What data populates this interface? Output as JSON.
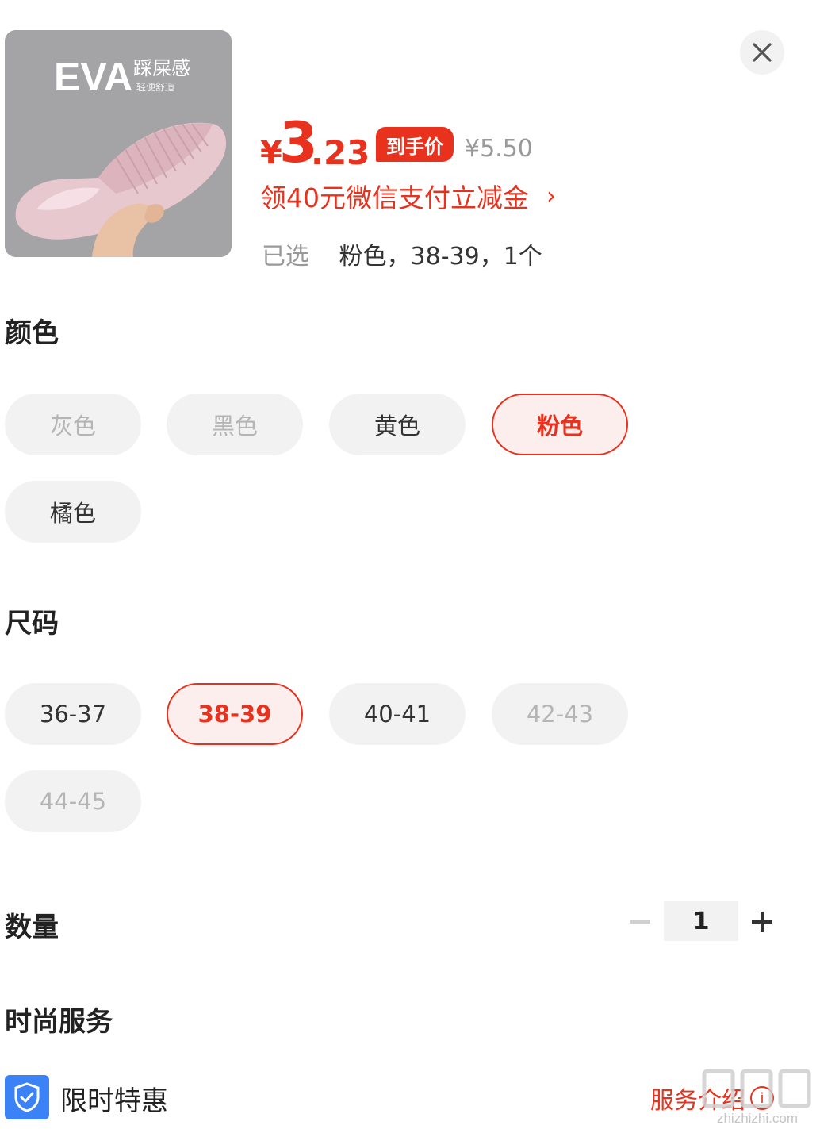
{
  "product": {
    "image_logo_text": "EVA",
    "image_slogan": "踩屎感",
    "image_subtitle": "轻便舒适"
  },
  "price": {
    "currency": "¥",
    "integer": "3",
    "decimal": ".23",
    "badge": "到手价",
    "original": "¥5.50"
  },
  "promo": {
    "text": "领40元微信支付立减金",
    "chevron": "›"
  },
  "selected": {
    "label": "已选",
    "value": "粉色，38-39，1个"
  },
  "color_section": {
    "title": "颜色",
    "options": [
      {
        "label": "灰色",
        "state": "disabled"
      },
      {
        "label": "黑色",
        "state": "disabled"
      },
      {
        "label": "黄色",
        "state": "normal"
      },
      {
        "label": "粉色",
        "state": "selected"
      },
      {
        "label": "橘色",
        "state": "normal"
      }
    ]
  },
  "size_section": {
    "title": "尺码",
    "options": [
      {
        "label": "36-37",
        "state": "normal"
      },
      {
        "label": "38-39",
        "state": "selected"
      },
      {
        "label": "40-41",
        "state": "normal"
      },
      {
        "label": "42-43",
        "state": "disabled"
      },
      {
        "label": "44-45",
        "state": "disabled"
      }
    ]
  },
  "quantity": {
    "title": "数量",
    "value": "1"
  },
  "service": {
    "title": "时尚服务",
    "item_label": "限时特惠",
    "link_text": "服务介绍",
    "info_glyph": "i"
  },
  "watermark": {
    "text": "zhizhizhi.com"
  },
  "colors": {
    "accent": "#e8321e",
    "chip_bg": "#f2f2f2",
    "chip_active_bg": "#fdeeee",
    "disabled_text": "#b5b5b5",
    "shield_blue": "#3b82f6"
  },
  "icons": {
    "close": "close-icon",
    "minus": "minus-icon",
    "plus": "plus-icon",
    "shield": "shield-icon",
    "info": "info-icon"
  }
}
